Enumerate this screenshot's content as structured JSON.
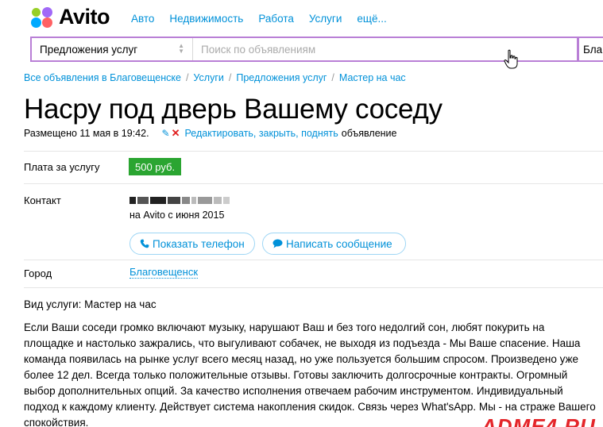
{
  "header": {
    "logo_text": "Avito",
    "nav": [
      "Авто",
      "Недвижимость",
      "Работа",
      "Услуги",
      "ещё..."
    ]
  },
  "search": {
    "category_value": "Предложения услуг",
    "placeholder": "Поиск по объявлениям",
    "city_value": "Бла"
  },
  "breadcrumb": [
    "Все объявления в Благовещенске",
    "Услуги",
    "Предложения услуг",
    "Мастер на час"
  ],
  "listing": {
    "title": "Насру под дверь Вашему соседу",
    "posted": "Размещено 11 мая в 19:42.",
    "edit_links": [
      "Редактировать",
      "закрыть",
      "поднять"
    ],
    "edit_tail": "объявление",
    "price_label": "Плата за услугу",
    "price": "500 руб.",
    "contact_label": "Контакт",
    "member_since": "на Avito с июня 2015",
    "phone_button": "Показать телефон",
    "message_button": "Написать сообщение",
    "city_label": "Город",
    "city": "Благовещенск",
    "service_type": "Вид услуги: Мастер на час",
    "description": "Если Ваши соседи громко включают музыку, нарушают Ваш и без того недолгий сон, любят покурить на площадке и настолько зажрались, что выгуливают собачек, не выходя из подъезда - Мы Ваше спасение. Наша команда появилась на рынке услуг всего месяц назад, но уже пользуется большим спросом. Произведено уже более 12 дел. Всегда только положительные отзывы. Готовы заключить долгосрочные контракты. Огромный выбор дополнительных опций. За качество исполнения отвечаем рабочим инструментом. Индивидуальный подход к каждому клиенту. Действует система накопления скидок. Связь через What'sApp. Мы - на страже Вашего спокойствия."
  },
  "watermark": "ADME4.RU",
  "colors": {
    "link": "#0091d9",
    "search_border": "#b97fd6",
    "price_badge": "#2aa531",
    "delete_cross": "#e02020",
    "watermark": "#e4262a"
  },
  "icons": [
    "avito-logo-dots",
    "select-arrows-icon",
    "hand-cursor-icon",
    "pencil-icon",
    "delete-cross-icon",
    "phone-icon",
    "chat-bubble-icon"
  ]
}
